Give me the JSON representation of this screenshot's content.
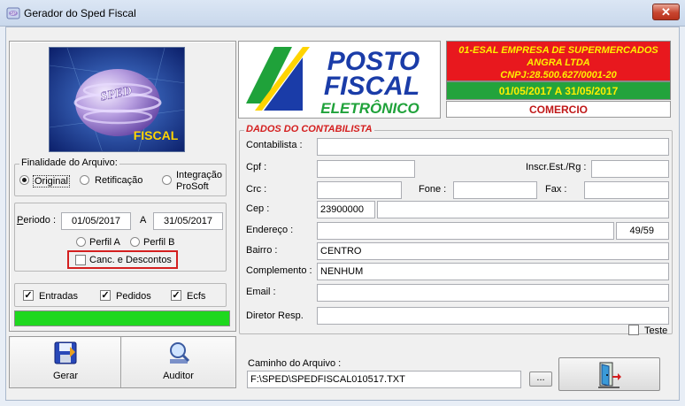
{
  "window": {
    "title": "Gerador do Sped Fiscal",
    "close_label": "✕"
  },
  "logo": {
    "sped_text": "SPED",
    "fiscal_text": "FISCAL"
  },
  "finalidade": {
    "label": "Finalidade do Arquivo:",
    "options": [
      "Original",
      "Retificação",
      "Integração ProSoft"
    ],
    "selected": "Original"
  },
  "periodo": {
    "label": "Periodo :",
    "start": "01/05/2017",
    "sep": "A",
    "end": "31/05/2017",
    "perfil_a": "Perfil A",
    "perfil_b": "Perfil B",
    "canc_label": "Canc. e Descontos"
  },
  "options": {
    "entradas": "Entradas",
    "pedidos": "Pedidos",
    "ecfs": "Ecfs"
  },
  "progress": {
    "value": 1.0,
    "color": "#1ed81e"
  },
  "buttons": {
    "gerar": "Gerar",
    "auditor": "Auditor"
  },
  "brand": {
    "line1": "POSTO",
    "line2": "FISCAL",
    "line3": "ELETRÔNICO"
  },
  "empresa": {
    "name1": "01-ESAL EMPRESA DE SUPERMERCADOS",
    "name2": "ANGRA LTDA",
    "cnpj": "CNPJ:28.500.627/0001-20",
    "period": "01/05/2017 A 31/05/2017",
    "tipo": "COMERCIO",
    "colors": {
      "red": "#e8181e",
      "yellow": "#ffef00",
      "green": "#23a33c",
      "darkred": "#c01818"
    }
  },
  "contabilista": {
    "section_title": "DADOS DO CONTABILISTA",
    "fields": {
      "contabilista": {
        "label": "Contabilista :",
        "value": ""
      },
      "cpf": {
        "label": "Cpf :",
        "value": ""
      },
      "inscr": {
        "label": "Inscr.Est./Rg :",
        "value": ""
      },
      "crc": {
        "label": "Crc :",
        "value": ""
      },
      "fone": {
        "label": "Fone :",
        "value": ""
      },
      "fax": {
        "label": "Fax :",
        "value": ""
      },
      "cep": {
        "label": "Cep :",
        "value": "23900000",
        "extra": ""
      },
      "endereco": {
        "label": "Endereço :",
        "value": "",
        "num": "49/59"
      },
      "bairro": {
        "label": "Bairro :",
        "value": "CENTRO"
      },
      "complemento": {
        "label": "Complemento :",
        "value": "NENHUM"
      },
      "email": {
        "label": "Email :",
        "value": ""
      },
      "diretor": {
        "label": "Diretor Resp.",
        "value": ""
      }
    },
    "teste_label": "Teste"
  },
  "caminho": {
    "label": "Caminho do Arquivo :",
    "value": "F:\\SPED\\SPEDFISCAL010517.TXT",
    "browse": "..."
  }
}
